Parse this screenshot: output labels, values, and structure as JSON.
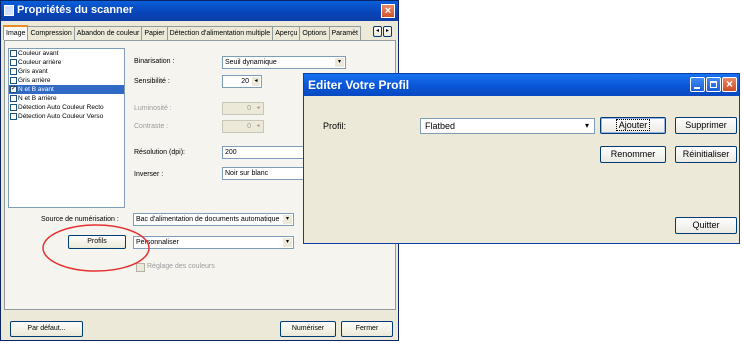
{
  "scanner_window": {
    "title": "Propriétés du scanner",
    "close_symbol": "×",
    "tabs": [
      "Image",
      "Compression",
      "Abandon de couleur",
      "Papier",
      "Détection d'alimentation multiple",
      "Aperçu",
      "Options",
      "Paramèt"
    ],
    "tab_scroll_left": "◂",
    "tab_scroll_right": "▸",
    "image_types": [
      {
        "label": "Couleur avant",
        "checked": false
      },
      {
        "label": "Couleur arrière",
        "checked": false
      },
      {
        "label": "Gris avant",
        "checked": false
      },
      {
        "label": "Gris arrière",
        "checked": false
      },
      {
        "label": "N et B avant",
        "checked": true
      },
      {
        "label": "N et B arrière",
        "checked": false
      },
      {
        "label": "Détection Auto Couleur Recto",
        "checked": false
      },
      {
        "label": "Détection Auto Couleur Verso",
        "checked": false
      }
    ],
    "binarisation_label": "Binarisation :",
    "binarisation_value": "Seuil dynamique",
    "sensibilite_label": "Sensibilité :",
    "sensibilite_value": "20",
    "luminosite_label": "Luminosité :",
    "luminosite_value": "0",
    "contraste_label": "Contraste :",
    "contraste_value": "0",
    "resolution_label": "Résolution (dpi):",
    "resolution_value": "200",
    "inverser_label": "Inverser :",
    "inverser_value": "Noir sur blanc",
    "source_label": "Source de numérisation :",
    "source_value": "Bac d'alimentation de documents automatique",
    "profils_button": "Profils",
    "profils_value": "Personnaliser",
    "reglage_label": "Réglage des couleurs",
    "default_button": "Par défaut...",
    "scan_button": "Numériser",
    "close_button": "Fermer",
    "dropdown_glyph": "▾",
    "spin_glyph": "◂"
  },
  "dialog": {
    "title": "Editer Votre Profil",
    "profile_label": "Profil:",
    "profile_value": "Flatbed",
    "add_button": "Ajouter",
    "delete_button": "Supprimer",
    "rename_button": "Renommer",
    "reset_button": "Réinitialiser",
    "quit_button": "Quitter",
    "close_symbol": "×"
  },
  "annotation": {
    "color": "#e53030"
  }
}
